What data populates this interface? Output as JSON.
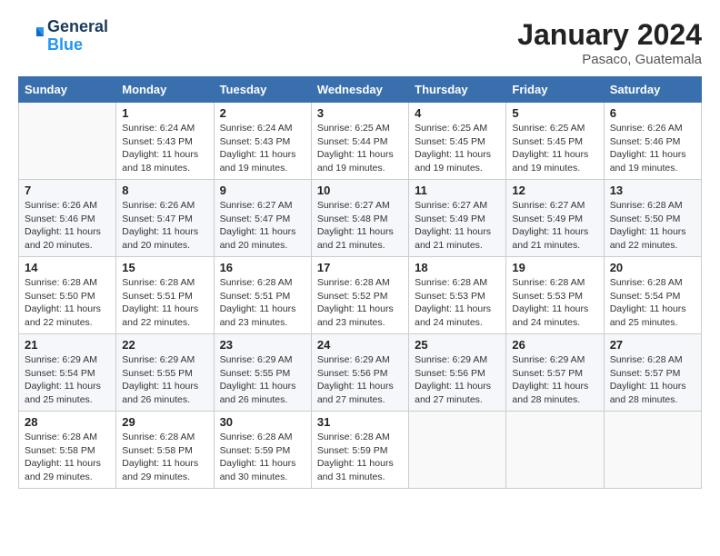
{
  "header": {
    "logo_line1": "General",
    "logo_line2": "Blue",
    "month": "January 2024",
    "location": "Pasaco, Guatemala"
  },
  "days_of_week": [
    "Sunday",
    "Monday",
    "Tuesday",
    "Wednesday",
    "Thursday",
    "Friday",
    "Saturday"
  ],
  "weeks": [
    [
      {
        "num": "",
        "info": ""
      },
      {
        "num": "1",
        "info": "Sunrise: 6:24 AM\nSunset: 5:43 PM\nDaylight: 11 hours\nand 18 minutes."
      },
      {
        "num": "2",
        "info": "Sunrise: 6:24 AM\nSunset: 5:43 PM\nDaylight: 11 hours\nand 19 minutes."
      },
      {
        "num": "3",
        "info": "Sunrise: 6:25 AM\nSunset: 5:44 PM\nDaylight: 11 hours\nand 19 minutes."
      },
      {
        "num": "4",
        "info": "Sunrise: 6:25 AM\nSunset: 5:45 PM\nDaylight: 11 hours\nand 19 minutes."
      },
      {
        "num": "5",
        "info": "Sunrise: 6:25 AM\nSunset: 5:45 PM\nDaylight: 11 hours\nand 19 minutes."
      },
      {
        "num": "6",
        "info": "Sunrise: 6:26 AM\nSunset: 5:46 PM\nDaylight: 11 hours\nand 19 minutes."
      }
    ],
    [
      {
        "num": "7",
        "info": "Sunrise: 6:26 AM\nSunset: 5:46 PM\nDaylight: 11 hours\nand 20 minutes."
      },
      {
        "num": "8",
        "info": "Sunrise: 6:26 AM\nSunset: 5:47 PM\nDaylight: 11 hours\nand 20 minutes."
      },
      {
        "num": "9",
        "info": "Sunrise: 6:27 AM\nSunset: 5:47 PM\nDaylight: 11 hours\nand 20 minutes."
      },
      {
        "num": "10",
        "info": "Sunrise: 6:27 AM\nSunset: 5:48 PM\nDaylight: 11 hours\nand 21 minutes."
      },
      {
        "num": "11",
        "info": "Sunrise: 6:27 AM\nSunset: 5:49 PM\nDaylight: 11 hours\nand 21 minutes."
      },
      {
        "num": "12",
        "info": "Sunrise: 6:27 AM\nSunset: 5:49 PM\nDaylight: 11 hours\nand 21 minutes."
      },
      {
        "num": "13",
        "info": "Sunrise: 6:28 AM\nSunset: 5:50 PM\nDaylight: 11 hours\nand 22 minutes."
      }
    ],
    [
      {
        "num": "14",
        "info": "Sunrise: 6:28 AM\nSunset: 5:50 PM\nDaylight: 11 hours\nand 22 minutes."
      },
      {
        "num": "15",
        "info": "Sunrise: 6:28 AM\nSunset: 5:51 PM\nDaylight: 11 hours\nand 22 minutes."
      },
      {
        "num": "16",
        "info": "Sunrise: 6:28 AM\nSunset: 5:51 PM\nDaylight: 11 hours\nand 23 minutes."
      },
      {
        "num": "17",
        "info": "Sunrise: 6:28 AM\nSunset: 5:52 PM\nDaylight: 11 hours\nand 23 minutes."
      },
      {
        "num": "18",
        "info": "Sunrise: 6:28 AM\nSunset: 5:53 PM\nDaylight: 11 hours\nand 24 minutes."
      },
      {
        "num": "19",
        "info": "Sunrise: 6:28 AM\nSunset: 5:53 PM\nDaylight: 11 hours\nand 24 minutes."
      },
      {
        "num": "20",
        "info": "Sunrise: 6:28 AM\nSunset: 5:54 PM\nDaylight: 11 hours\nand 25 minutes."
      }
    ],
    [
      {
        "num": "21",
        "info": "Sunrise: 6:29 AM\nSunset: 5:54 PM\nDaylight: 11 hours\nand 25 minutes."
      },
      {
        "num": "22",
        "info": "Sunrise: 6:29 AM\nSunset: 5:55 PM\nDaylight: 11 hours\nand 26 minutes."
      },
      {
        "num": "23",
        "info": "Sunrise: 6:29 AM\nSunset: 5:55 PM\nDaylight: 11 hours\nand 26 minutes."
      },
      {
        "num": "24",
        "info": "Sunrise: 6:29 AM\nSunset: 5:56 PM\nDaylight: 11 hours\nand 27 minutes."
      },
      {
        "num": "25",
        "info": "Sunrise: 6:29 AM\nSunset: 5:56 PM\nDaylight: 11 hours\nand 27 minutes."
      },
      {
        "num": "26",
        "info": "Sunrise: 6:29 AM\nSunset: 5:57 PM\nDaylight: 11 hours\nand 28 minutes."
      },
      {
        "num": "27",
        "info": "Sunrise: 6:28 AM\nSunset: 5:57 PM\nDaylight: 11 hours\nand 28 minutes."
      }
    ],
    [
      {
        "num": "28",
        "info": "Sunrise: 6:28 AM\nSunset: 5:58 PM\nDaylight: 11 hours\nand 29 minutes."
      },
      {
        "num": "29",
        "info": "Sunrise: 6:28 AM\nSunset: 5:58 PM\nDaylight: 11 hours\nand 29 minutes."
      },
      {
        "num": "30",
        "info": "Sunrise: 6:28 AM\nSunset: 5:59 PM\nDaylight: 11 hours\nand 30 minutes."
      },
      {
        "num": "31",
        "info": "Sunrise: 6:28 AM\nSunset: 5:59 PM\nDaylight: 11 hours\nand 31 minutes."
      },
      {
        "num": "",
        "info": ""
      },
      {
        "num": "",
        "info": ""
      },
      {
        "num": "",
        "info": ""
      }
    ]
  ]
}
